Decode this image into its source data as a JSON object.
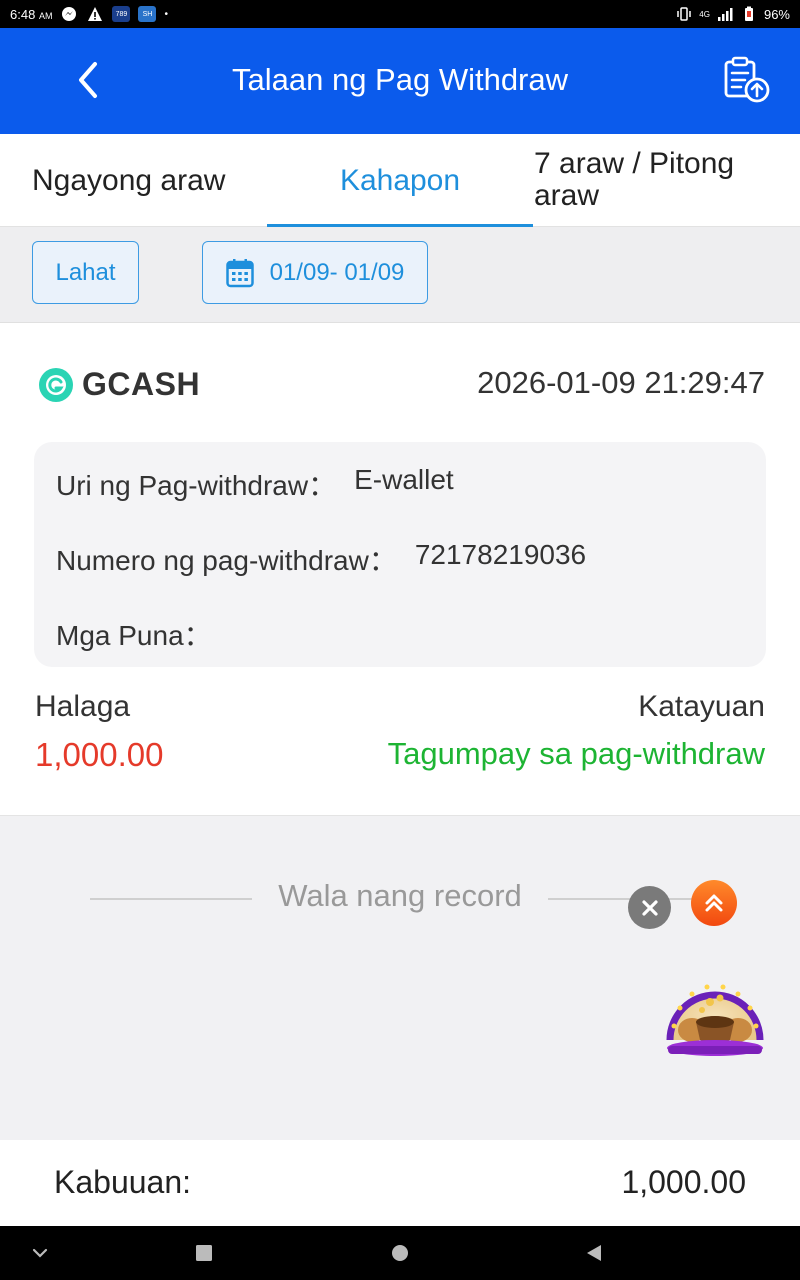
{
  "status_bar": {
    "time": "6:48",
    "ampm": "AM",
    "icon_badge_1": "789",
    "icon_badge_2": "SH",
    "network": "4G",
    "battery": "96%"
  },
  "header": {
    "title": "Talaan ng Pag Withdraw"
  },
  "tabs": {
    "today": "Ngayong araw",
    "yesterday": "Kahapon",
    "week": "7 araw / Pitong araw",
    "active": "yesterday"
  },
  "filters": {
    "all_label": "Lahat",
    "date_range": "01/09- 01/09"
  },
  "record": {
    "method": "GCASH",
    "datetime": "2026-01-09 21:29:47",
    "type_label": "Uri ng Pag-withdraw：",
    "type_value": "E-wallet",
    "number_label": "Numero ng pag-withdraw：",
    "number_value": "72178219036",
    "remarks_label": "Mga Puna：",
    "remarks_value": "",
    "amount_label": "Halaga",
    "amount_value": "1,000.00",
    "status_label": "Katayuan",
    "status_value": "Tagumpay sa pag-withdraw"
  },
  "no_more": "Wala nang record",
  "summary": {
    "total_label": "Kabuuan:",
    "total_value": "1,000.00"
  },
  "colors": {
    "header_blue": "#0b5bec",
    "tab_active": "#1e8fdc",
    "amount_red": "#e53a2a",
    "status_green": "#1db433"
  },
  "icons": {
    "back": "chevron-left-icon",
    "history": "clipboard-upload-icon",
    "calendar": "calendar-icon",
    "close": "close-icon",
    "scroll_top": "double-chevron-up-icon",
    "promo": "treasure-bowl-icon"
  }
}
